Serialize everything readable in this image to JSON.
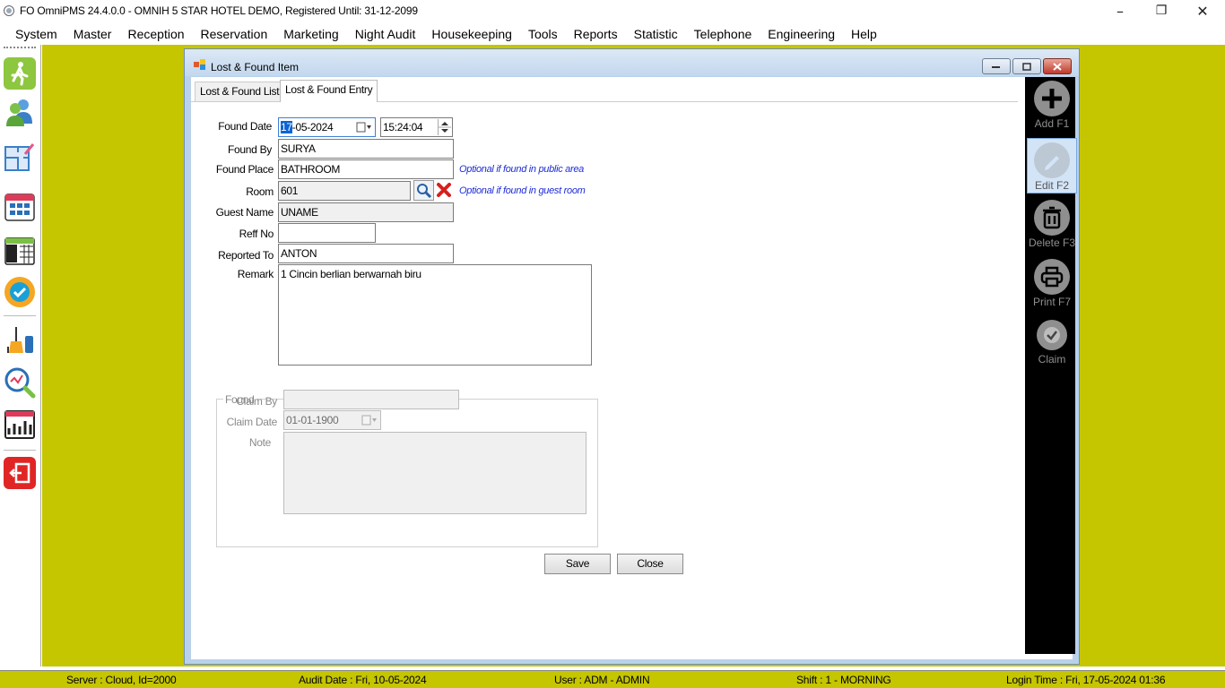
{
  "window": {
    "title": "FO OmniPMS 24.4.0.0 - OMNIH 5 STAR HOTEL DEMO, Registered Until: 31-12-2099",
    "minimize_glyph": "–",
    "maximize_glyph": "❐",
    "close_glyph": "✕"
  },
  "menu": [
    "System",
    "Master",
    "Reception",
    "Reservation",
    "Marketing",
    "Night Audit",
    "Housekeeping",
    "Tools",
    "Reports",
    "Statistic",
    "Telephone",
    "Engineering",
    "Help"
  ],
  "left_toolbar": {
    "icons": [
      "walk-in-icon",
      "guests-icon",
      "floor-plan-icon",
      "room-calendar-icon",
      "calendar-2023-icon",
      "guarantee-badge-icon",
      "housekeeping-icon",
      "search-analytics-icon",
      "statistics-chart-icon",
      "exit-icon"
    ]
  },
  "child": {
    "title": "Lost & Found Item",
    "tabs": [
      "Lost & Found List",
      "Lost & Found Entry"
    ],
    "active_tab": "Lost & Found Entry"
  },
  "form": {
    "found_date": {
      "label": "Found Date",
      "value_selected": "17",
      "value_rest": "-05-2024"
    },
    "found_time": {
      "value": "15:24:04"
    },
    "found_by": {
      "label": "Found By",
      "value": "SURYA"
    },
    "found_place": {
      "label": "Found Place",
      "value": "BATHROOM",
      "hint": "Optional if found in public area"
    },
    "room": {
      "label": "Room",
      "value": "601",
      "hint": "Optional if found in guest room"
    },
    "guest_name": {
      "label": "Guest Name",
      "value": "UNAME"
    },
    "reff_no": {
      "label": "Reff No",
      "value": ""
    },
    "reported_to": {
      "label": "Reported To",
      "value": "ANTON"
    },
    "remark": {
      "label": "Remark",
      "value": "1 Cincin berlian berwarnah biru"
    },
    "found_group": {
      "label": "Found",
      "claim_by": {
        "label": "Claim By",
        "value": ""
      },
      "claim_date": {
        "label": "Claim Date",
        "value": "01-01-1900"
      },
      "note": {
        "label": "Note",
        "value": ""
      }
    },
    "save_label": "Save",
    "close_label": "Close"
  },
  "actions": [
    {
      "label": "Add F1",
      "icon": "add-icon"
    },
    {
      "label": "Edit F2",
      "icon": "edit-icon"
    },
    {
      "label": "Delete F3",
      "icon": "trash-icon"
    },
    {
      "label": "Print F7",
      "icon": "printer-icon"
    },
    {
      "label": "Claim",
      "icon": "claim-check-icon"
    }
  ],
  "status": {
    "server": "Server : Cloud, Id=2000",
    "audit_date": "Audit Date : Fri, 10-05-2024",
    "user": "User : ADM - ADMIN",
    "shift": "Shift : 1 - MORNING",
    "login_time": "Login Time : Fri, 17-05-2024 01:36"
  },
  "colors": {
    "workspace": "#c5c500",
    "action_panel": "#000000",
    "hint_text": "#1c2bd6",
    "selection": "#0a64d6",
    "close_x": "#d62020"
  }
}
